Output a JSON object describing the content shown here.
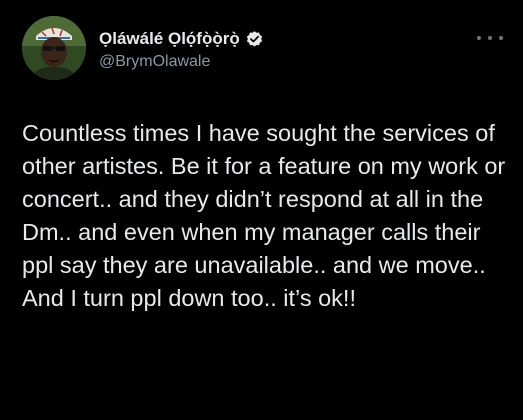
{
  "tweet": {
    "author": {
      "display_name": "Ọláwálé Ọlọ́fọ̀ọ̀rọ̀",
      "handle": "@BrymOlawale",
      "verified": true,
      "avatar_icon": "profile-avatar"
    },
    "more_icon": "more-dots-icon",
    "text": "Countless times I have sought the services of other artistes. Be it for a feature on my work or concert.. and they didn’t respond at all in the Dm.. and even when my manager calls their ppl say they are unavailable.. and we move.. And I turn ppl down too.. it’s ok!!"
  },
  "colors": {
    "background": "#000000",
    "text_primary": "#e7e9ea",
    "text_secondary": "#8b98a5",
    "verified_badge": "#e7e9ea"
  }
}
